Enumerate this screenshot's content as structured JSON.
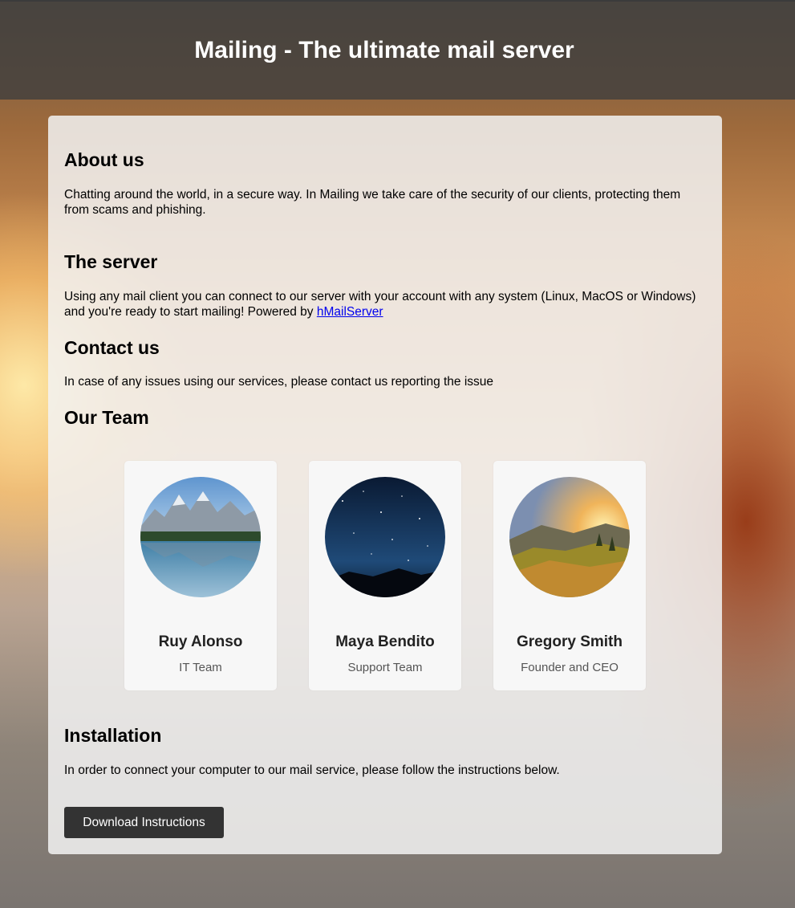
{
  "header": {
    "title": "Mailing - The ultimate mail server"
  },
  "about": {
    "heading": "About us",
    "text": "Chatting around the world, in a secure way. In Mailing we take care of the security of our clients, protecting them from scams and phishing."
  },
  "server": {
    "heading": "The server",
    "text": "Using any mail client you can connect to our server with your account with any system (Linux, MacOS or Windows) and you're ready to start mailing! Powered by ",
    "link_label": "hMailServer"
  },
  "contact": {
    "heading": "Contact us",
    "text": "In case of any issues using our services, please contact us reporting the issue"
  },
  "team": {
    "heading": "Our Team",
    "members": [
      {
        "name": "Ruy Alonso",
        "role": "IT Team",
        "photo": "mountain-lake"
      },
      {
        "name": "Maya Bendito",
        "role": "Support Team",
        "photo": "starry-night"
      },
      {
        "name": "Gregory Smith",
        "role": "Founder and CEO",
        "photo": "sunset-hills"
      }
    ]
  },
  "installation": {
    "heading": "Installation",
    "text": "In order to connect your computer to our mail service, please follow the instructions below.",
    "button_label": "Download Instructions"
  },
  "colors": {
    "header_bg": "#3e3e3e",
    "card_bg": "#f2f2f2",
    "button_bg": "#333333",
    "link": "#0000ee"
  }
}
